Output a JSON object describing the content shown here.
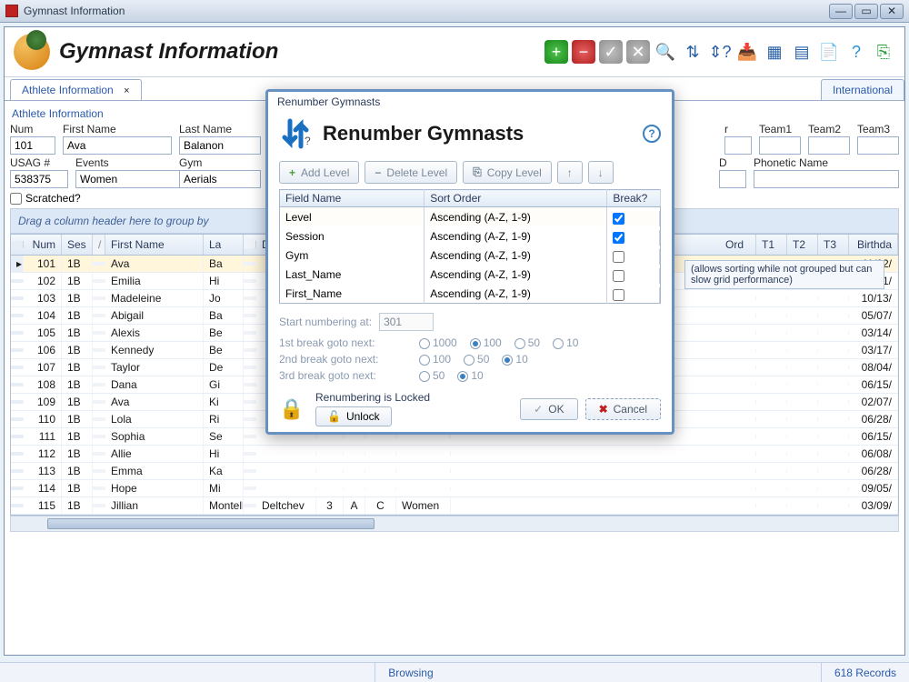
{
  "window": {
    "title": "Gymnast Information"
  },
  "header": {
    "heading": "Gymnast Information"
  },
  "tabs": [
    {
      "label": "Athlete Information",
      "active": true
    },
    {
      "label": "International",
      "active": false
    }
  ],
  "athlete_form": {
    "labels": {
      "num": "Num",
      "first_name": "First Name",
      "last_name": "Last Name",
      "usag": "USAG #",
      "events": "Events",
      "gym": "Gym",
      "r": "r",
      "team1": "Team1",
      "team2": "Team2",
      "team3": "Team3",
      "d": "D",
      "phonetic": "Phonetic Name",
      "scratched": "Scratched?"
    },
    "values": {
      "num": "101",
      "first_name": "Ava",
      "last_name": "Balanon",
      "usag": "538375",
      "events": "Women",
      "gym": "Aerials",
      "r": "",
      "team1": "",
      "team2": "",
      "team3": "",
      "d": "",
      "phonetic": "",
      "scratched": false
    }
  },
  "grid": {
    "group_hint": "Drag a column header here to group by",
    "note": "(allows sorting while not grouped but can slow grid performance)",
    "columns": [
      "",
      "Num",
      "Ses",
      "/",
      "First Name",
      "La",
      "",
      "Deltchev",
      "3",
      "A",
      "C",
      "Women",
      "Ord",
      "T1",
      "T2",
      "T3",
      "Birthda"
    ],
    "rows": [
      {
        "num": "101",
        "ses": "1B",
        "first_name": "Ava",
        "la": "Ba",
        "bday": "11/02/"
      },
      {
        "num": "102",
        "ses": "1B",
        "first_name": "Emilia",
        "la": "Hi",
        "bday": "11/11/"
      },
      {
        "num": "103",
        "ses": "1B",
        "first_name": "Madeleine",
        "la": "Jo",
        "bday": "10/13/"
      },
      {
        "num": "104",
        "ses": "1B",
        "first_name": "Abigail",
        "la": "Ba",
        "bday": "05/07/"
      },
      {
        "num": "105",
        "ses": "1B",
        "first_name": "Alexis",
        "la": "Be",
        "bday": "03/14/"
      },
      {
        "num": "106",
        "ses": "1B",
        "first_name": "Kennedy",
        "la": "Be",
        "bday": "03/17/"
      },
      {
        "num": "107",
        "ses": "1B",
        "first_name": "Taylor",
        "la": "De",
        "bday": "08/04/"
      },
      {
        "num": "108",
        "ses": "1B",
        "first_name": "Dana",
        "la": "Gi",
        "bday": "06/15/"
      },
      {
        "num": "109",
        "ses": "1B",
        "first_name": "Ava",
        "la": "Ki",
        "bday": "02/07/"
      },
      {
        "num": "110",
        "ses": "1B",
        "first_name": "Lola",
        "la": "Ri",
        "bday": "06/28/"
      },
      {
        "num": "111",
        "ses": "1B",
        "first_name": "Sophia",
        "la": "Se",
        "bday": "06/15/"
      },
      {
        "num": "112",
        "ses": "1B",
        "first_name": "Allie",
        "la": "Hi",
        "bday": "06/08/"
      },
      {
        "num": "113",
        "ses": "1B",
        "first_name": "Emma",
        "la": "Ka",
        "bday": "06/28/"
      },
      {
        "num": "114",
        "ses": "1B",
        "first_name": "Hope",
        "la": "Mi",
        "bday": "09/05/"
      },
      {
        "num": "115",
        "ses": "1B",
        "first_name": "Jillian",
        "la": "Montella",
        "deltchev": "Deltchev",
        "c3": "3",
        "ca": "A",
        "cc": "C",
        "wom": "Women",
        "bday": "03/09/"
      }
    ]
  },
  "status": {
    "browsing": "Browsing",
    "records": "618 Records"
  },
  "dialog": {
    "title": "Renumber Gymnasts",
    "heading": "Renumber Gymnasts",
    "buttons": {
      "add": "Add Level",
      "delete": "Delete Level",
      "copy": "Copy Level"
    },
    "table": {
      "headers": {
        "field": "Field Name",
        "sort": "Sort Order",
        "break": "Break?"
      },
      "rows": [
        {
          "field": "Level",
          "sort": "Ascending (A-Z, 1-9)",
          "break": true
        },
        {
          "field": "Session",
          "sort": "Ascending (A-Z, 1-9)",
          "break": true
        },
        {
          "field": "Gym",
          "sort": "Ascending (A-Z, 1-9)",
          "break": false
        },
        {
          "field": "Last_Name",
          "sort": "Ascending (A-Z, 1-9)",
          "break": false
        },
        {
          "field": "First_Name",
          "sort": "Ascending (A-Z, 1-9)",
          "break": false
        }
      ]
    },
    "start_label": "Start numbering at:",
    "start_value": "301",
    "breaks": [
      {
        "label": "1st break goto next:",
        "options": [
          "1000",
          "100",
          "50",
          "10"
        ],
        "selected": "100"
      },
      {
        "label": "2nd break goto next:",
        "options": [
          "100",
          "50",
          "10"
        ],
        "selected": "10"
      },
      {
        "label": "3rd break goto next:",
        "options": [
          "50",
          "10"
        ],
        "selected": "10"
      }
    ],
    "lock": {
      "message": "Renumbering is Locked",
      "unlock_label": "Unlock"
    },
    "actions": {
      "ok": "OK",
      "cancel": "Cancel"
    }
  }
}
